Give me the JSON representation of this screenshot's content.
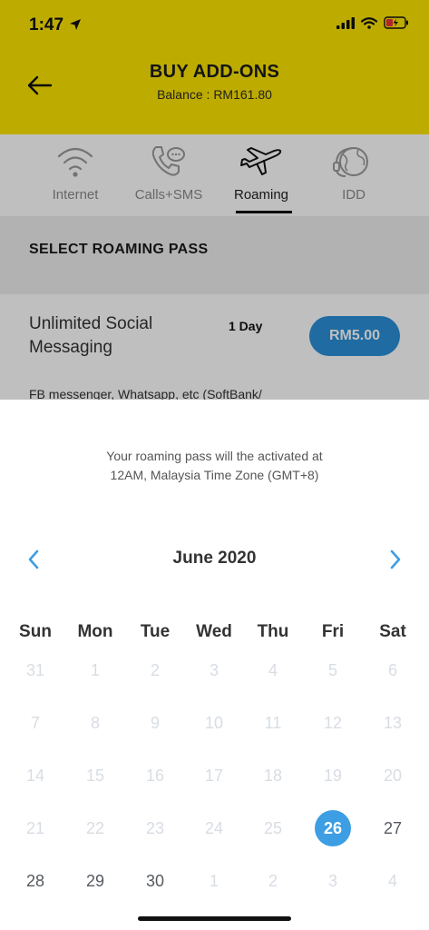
{
  "status_bar": {
    "time": "1:47"
  },
  "header": {
    "title": "BUY ADD-ONS",
    "balance": "Balance : RM161.80"
  },
  "tabs": [
    {
      "label": "Internet",
      "icon": "wifi-icon",
      "active": false
    },
    {
      "label": "Calls+SMS",
      "icon": "phone-chat-icon",
      "active": false
    },
    {
      "label": "Roaming",
      "icon": "airplane-icon",
      "active": true
    },
    {
      "label": "IDD",
      "icon": "globe-headset-icon",
      "active": false
    }
  ],
  "section": {
    "title": "SELECT ROAMING PASS"
  },
  "pass": {
    "name": "Unlimited Social Messaging",
    "duration": "1 Day",
    "price": "RM5.00",
    "description": "FB messenger, Whatsapp, etc (SoftBank/"
  },
  "sheet": {
    "notice_line1": "Your roaming pass will the activated at",
    "notice_line2": "12AM, Malaysia Time Zone (GMT+8)",
    "month": "June 2020",
    "weekdays": [
      "Sun",
      "Mon",
      "Tue",
      "Wed",
      "Thu",
      "Fri",
      "Sat"
    ],
    "selected_day": "26",
    "weeks": [
      [
        "31",
        "1",
        "2",
        "3",
        "4",
        "5",
        "6"
      ],
      [
        "7",
        "8",
        "9",
        "10",
        "11",
        "12",
        "13"
      ],
      [
        "14",
        "15",
        "16",
        "17",
        "18",
        "19",
        "20"
      ],
      [
        "21",
        "22",
        "23",
        "24",
        "25",
        "26",
        "27"
      ],
      [
        "28",
        "29",
        "30",
        "1",
        "2",
        "3",
        "4"
      ]
    ],
    "enabled_days": [
      "27",
      "28",
      "29",
      "30"
    ]
  },
  "colors": {
    "header_yellow": "#fde500",
    "accent_blue": "#3d9ee3",
    "button_blue": "#2a8fd8"
  }
}
